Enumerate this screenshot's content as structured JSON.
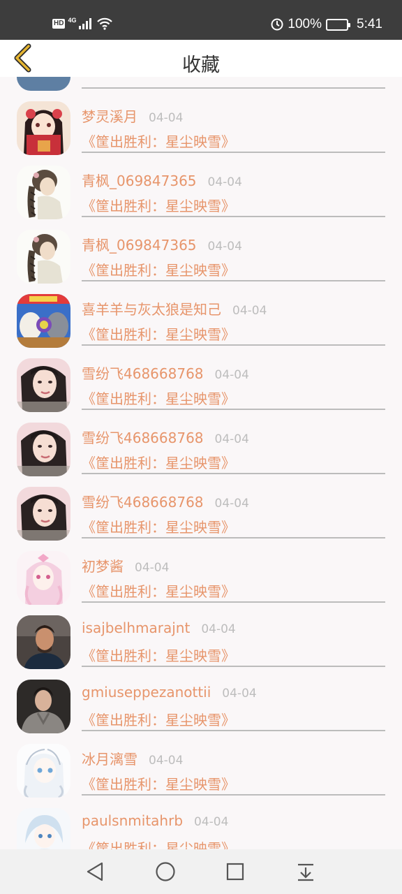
{
  "status_bar": {
    "hd": "HD",
    "network": "4G",
    "battery_percent": "100%",
    "time": "5:41",
    "icons": [
      "signal-icon",
      "wifi-icon",
      "data-saver-icon",
      "battery-icon"
    ]
  },
  "header": {
    "title": "收藏",
    "back_icon": "chevron-left-icon",
    "accent_color": "#e5b532"
  },
  "colors": {
    "name_text": "#e7956b",
    "time_text": "#bdbdbd",
    "divider": "#bcbcbc",
    "background": "#faf7f8"
  },
  "favorites": [
    {
      "name": "",
      "time": "",
      "book": "",
      "avatar": "partial-avatar"
    },
    {
      "name": "梦灵溪月",
      "time": "04-04",
      "book": "《筐出胜利：星尘映雪》",
      "avatar": "anime-girl-red"
    },
    {
      "name": "青枫_069847365",
      "time": "04-04",
      "book": "《筐出胜利：星尘映雪》",
      "avatar": "braided-girl"
    },
    {
      "name": "青枫_069847365",
      "time": "04-04",
      "book": "《筐出胜利：星尘映雪》",
      "avatar": "braided-girl"
    },
    {
      "name": "喜羊羊与灰太狼是知己",
      "time": "04-04",
      "book": "《筐出胜利：星尘映雪》",
      "avatar": "cartoon-poster"
    },
    {
      "name": "雪纷飞468668768",
      "time": "04-04",
      "book": "《筐出胜利：星尘映雪》",
      "avatar": "girl-photo"
    },
    {
      "name": "雪纷飞468668768",
      "time": "04-04",
      "book": "《筐出胜利：星尘映雪》",
      "avatar": "girl-photo"
    },
    {
      "name": "雪纷飞468668768",
      "time": "04-04",
      "book": "《筐出胜利：星尘映雪》",
      "avatar": "girl-photo"
    },
    {
      "name": "初梦酱",
      "time": "04-04",
      "book": "《筐出胜利：星尘映雪》",
      "avatar": "pink-anime"
    },
    {
      "name": "isajbelhmarajnt",
      "time": "04-04",
      "book": "《筐出胜利：星尘映雪》",
      "avatar": "man-dark"
    },
    {
      "name": "gmiuseppezanottii",
      "time": "04-04",
      "book": "《筐出胜利：星尘映雪》",
      "avatar": "man-hoodie"
    },
    {
      "name": "冰月漓雪",
      "time": "04-04",
      "book": "《筐出胜利：星尘映雪》",
      "avatar": "white-anime"
    },
    {
      "name": "paulsnmitahrb",
      "time": "04-04",
      "book": "《筐出胜利：星尘映雪》",
      "avatar": "blue-anime"
    }
  ],
  "nav_bar": {
    "back_icon": "triangle-back-icon",
    "home_icon": "circle-home-icon",
    "recents_icon": "square-recents-icon",
    "notification_icon": "pull-down-icon"
  }
}
